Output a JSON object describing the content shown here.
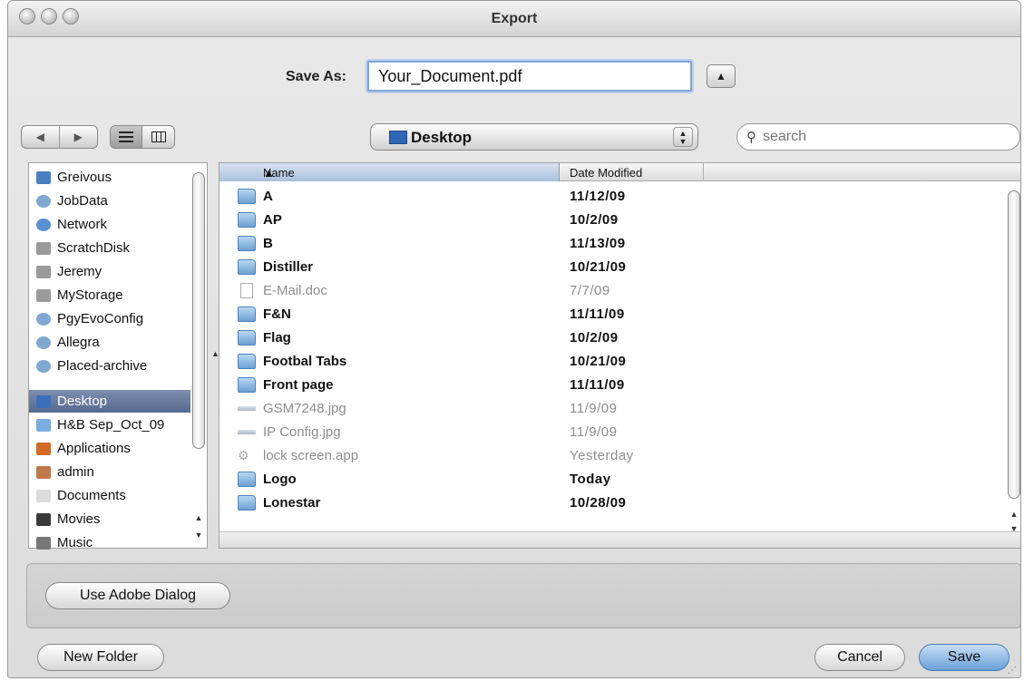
{
  "window": {
    "title": "Export"
  },
  "save_as": {
    "label": "Save As:",
    "value": "Your_Document.pdf"
  },
  "location": {
    "label": "Desktop"
  },
  "search": {
    "placeholder": "search"
  },
  "sidebar": {
    "items": [
      {
        "label": "Greivous",
        "icon": "computer-icon"
      },
      {
        "label": "JobData",
        "icon": "network-volume-icon"
      },
      {
        "label": "Network",
        "icon": "network-globe-icon"
      },
      {
        "label": "ScratchDisk",
        "icon": "hard-disk-icon"
      },
      {
        "label": "Jeremy",
        "icon": "hard-disk-icon"
      },
      {
        "label": "MyStorage",
        "icon": "hard-disk-icon"
      },
      {
        "label": "PgyEvoConfig",
        "icon": "network-volume-icon"
      },
      {
        "label": "Allegra",
        "icon": "network-volume-icon"
      },
      {
        "label": "Placed-archive",
        "icon": "network-volume-icon"
      },
      {
        "label": "Desktop",
        "icon": "desktop-icon",
        "selected": true
      },
      {
        "label": "H&B Sep_Oct_09",
        "icon": "folder-icon"
      },
      {
        "label": "Applications",
        "icon": "applications-icon"
      },
      {
        "label": "admin",
        "icon": "home-icon"
      },
      {
        "label": "Documents",
        "icon": "documents-icon"
      },
      {
        "label": "Movies",
        "icon": "movies-icon"
      },
      {
        "label": "Music",
        "icon": "music-icon"
      }
    ]
  },
  "columns": {
    "name": "Name",
    "date": "Date Modified"
  },
  "files": [
    {
      "name": "A",
      "date": "11/12/09",
      "kind": "folder",
      "enabled": true
    },
    {
      "name": "AP",
      "date": "10/2/09",
      "kind": "folder",
      "enabled": true
    },
    {
      "name": "B",
      "date": "11/13/09",
      "kind": "folder",
      "enabled": true
    },
    {
      "name": "Distiller",
      "date": "10/21/09",
      "kind": "folder",
      "enabled": true
    },
    {
      "name": "E-Mail.doc",
      "date": "7/7/09",
      "kind": "doc",
      "enabled": false
    },
    {
      "name": "F&N",
      "date": "11/11/09",
      "kind": "folder",
      "enabled": true
    },
    {
      "name": "Flag",
      "date": "10/2/09",
      "kind": "folder",
      "enabled": true
    },
    {
      "name": "Footbal Tabs",
      "date": "10/21/09",
      "kind": "folder",
      "enabled": true
    },
    {
      "name": "Front page",
      "date": "11/11/09",
      "kind": "folder",
      "enabled": true
    },
    {
      "name": "GSM7248.jpg",
      "date": "11/9/09",
      "kind": "image",
      "enabled": false
    },
    {
      "name": "IP Config.jpg",
      "date": "11/9/09",
      "kind": "image",
      "enabled": false
    },
    {
      "name": "lock screen.app",
      "date": "Yesterday",
      "kind": "app",
      "enabled": false
    },
    {
      "name": "Logo",
      "date": "Today",
      "kind": "folder",
      "enabled": true
    },
    {
      "name": "Lonestar",
      "date": "10/28/09",
      "kind": "folder",
      "enabled": true
    }
  ],
  "buttons": {
    "adobe_dialog": "Use Adobe Dialog",
    "new_folder": "New Folder",
    "cancel": "Cancel",
    "save": "Save"
  }
}
